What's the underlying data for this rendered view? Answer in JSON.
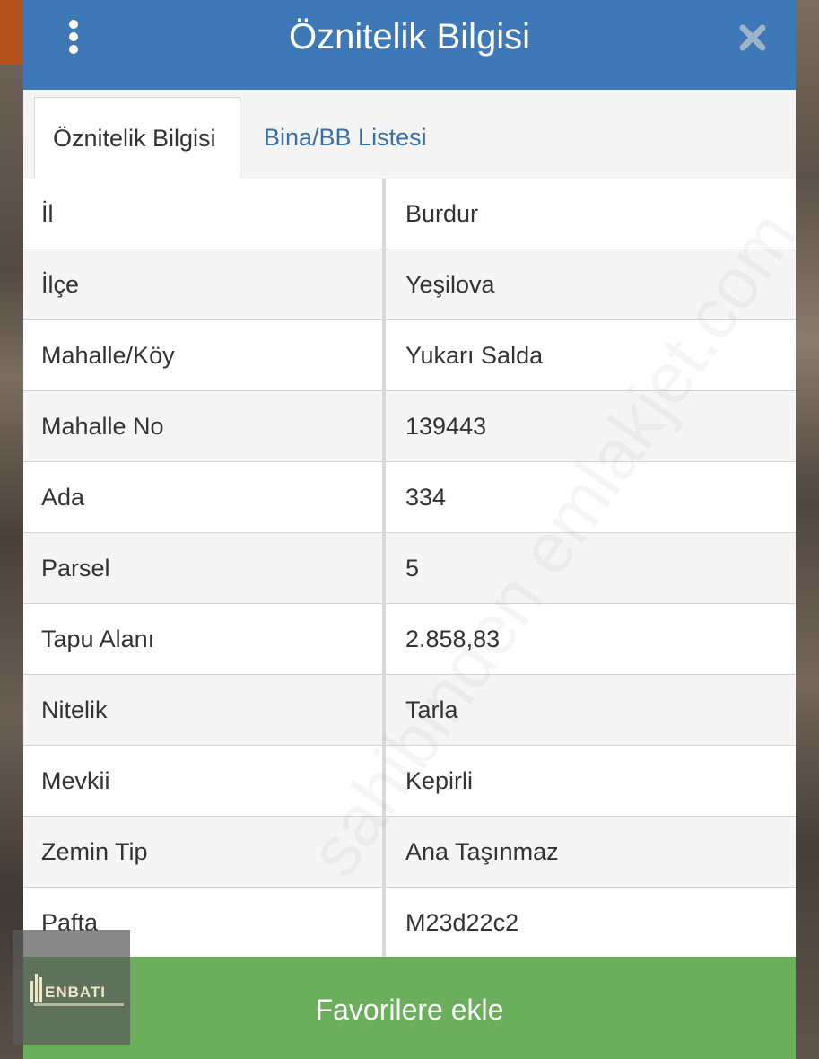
{
  "header": {
    "title": "Öznitelik Bilgisi",
    "menu_icon": "kebab-menu-icon",
    "close_icon": "close-icon",
    "color": "#3f78b6"
  },
  "tabs": [
    {
      "label": "Öznitelik Bilgisi",
      "active": true
    },
    {
      "label": "Bina/BB Listesi",
      "active": false
    }
  ],
  "attributes": [
    {
      "label": "İl",
      "value": "Burdur"
    },
    {
      "label": "İlçe",
      "value": "Yeşilova"
    },
    {
      "label": "Mahalle/Köy",
      "value": "Yukarı Salda"
    },
    {
      "label": "Mahalle No",
      "value": "139443"
    },
    {
      "label": "Ada",
      "value": "334"
    },
    {
      "label": "Parsel",
      "value": "5"
    },
    {
      "label": "Tapu Alanı",
      "value": "2.858,83"
    },
    {
      "label": "Nitelik",
      "value": "Tarla"
    },
    {
      "label": "Mevkii",
      "value": "Kepirli"
    },
    {
      "label": "Zemin Tip",
      "value": "Ana Taşınmaz"
    },
    {
      "label": "Pafta",
      "value": "M23d22c2"
    }
  ],
  "footer": {
    "favorite_label": "Favorilere ekle",
    "color": "#6bae5c"
  },
  "overlay_logo": {
    "text": "ENBATI"
  }
}
